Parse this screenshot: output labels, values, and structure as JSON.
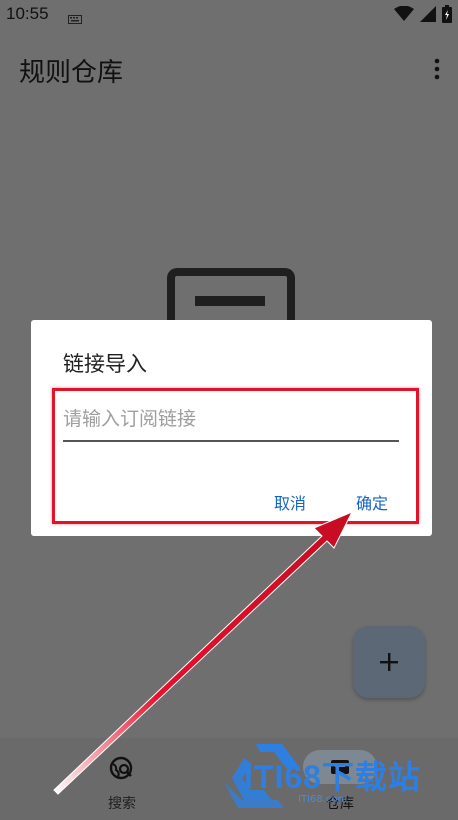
{
  "status_bar": {
    "time": "10:55"
  },
  "app_bar": {
    "title": "规则仓库"
  },
  "dialog": {
    "title": "链接导入",
    "input_value": "",
    "input_placeholder": "请输入订阅链接",
    "cancel_label": "取消",
    "confirm_label": "确定"
  },
  "fab": {
    "label": "+"
  },
  "bottom_nav": {
    "items": [
      {
        "label": "搜索",
        "icon": "search-globe-icon",
        "selected": false
      },
      {
        "label": "仓库",
        "icon": "repository-icon",
        "selected": true
      }
    ]
  },
  "watermark": {
    "text": "ITI68下载站",
    "sub": "ITI68.com"
  },
  "colors": {
    "scrim": "#6f6f6f",
    "dialog_button": "#1565c0",
    "annotation_red": "#e4112b",
    "fab": "#5c6875",
    "nav_selected_pill": "#7e8893"
  }
}
